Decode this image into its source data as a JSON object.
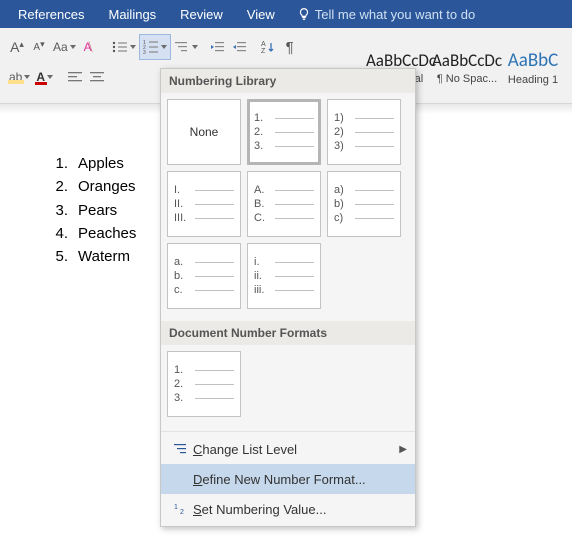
{
  "tabs": {
    "t0": "References",
    "t1": "Mailings",
    "t2": "Review",
    "t3": "View"
  },
  "tellme": "Tell me what you want to do",
  "styles": {
    "s0": {
      "sample": "AaBbCcDc",
      "cap": "¶ Normal"
    },
    "s1": {
      "sample": "AaBbCcDc",
      "cap": "¶ No Spac..."
    },
    "s2": {
      "sample": "AaBbC",
      "cap": "Heading 1"
    }
  },
  "doc_list": {
    "i1": "Apples",
    "i2": "Oranges",
    "i3": "Pears",
    "i4": "Peaches",
    "i5": "Waterm"
  },
  "panel": {
    "header1": "Numbering Library",
    "header2": "Document Number Formats",
    "none": "None",
    "tiles": {
      "arabic_dot": {
        "a": "1.",
        "b": "2.",
        "c": "3."
      },
      "arabic_paren": {
        "a": "1)",
        "b": "2)",
        "c": "3)"
      },
      "roman_upper": {
        "a": "I.",
        "b": "II.",
        "c": "III."
      },
      "alpha_upper": {
        "a": "A.",
        "b": "B.",
        "c": "C."
      },
      "alpha_lower_paren": {
        "a": "a)",
        "b": "b)",
        "c": "c)"
      },
      "alpha_lower_dot": {
        "a": "a.",
        "b": "b.",
        "c": "c."
      },
      "roman_lower": {
        "a": "i.",
        "b": "ii.",
        "c": "iii."
      },
      "doc_arabic": {
        "a": "1.",
        "b": "2.",
        "c": "3."
      }
    },
    "menu": {
      "change": "Change List Level",
      "define": "Define New Number Format...",
      "setval": "Set Numbering Value..."
    }
  }
}
